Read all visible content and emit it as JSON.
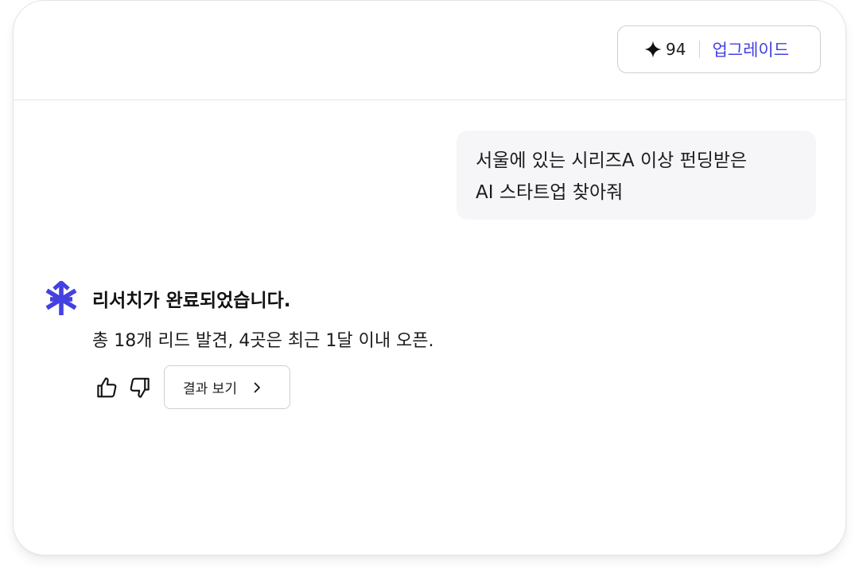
{
  "header": {
    "credits": "94",
    "upgrade_label": "업그레이드"
  },
  "chat": {
    "user_message_lines": [
      "서울에 있는 시리즈A 이상 펀딩받은",
      "AI 스타트업 찾아줘"
    ],
    "assistant": {
      "title": "리서치가 완료되었습니다.",
      "body": "총 18개 리드 발견, 4곳은 최근 1달 이내 오픈.",
      "result_button_label": "결과 보기"
    }
  },
  "icons": {
    "credits": "sparkle-icon",
    "assistant": "asterisk-logo-icon",
    "like": "thumbs-up-icon",
    "dislike": "thumbs-down-icon",
    "result": "chevron-right-icon"
  },
  "colors": {
    "accent": "#4540e0",
    "text": "#1c1c1e",
    "bubble": "#f6f6f9"
  }
}
